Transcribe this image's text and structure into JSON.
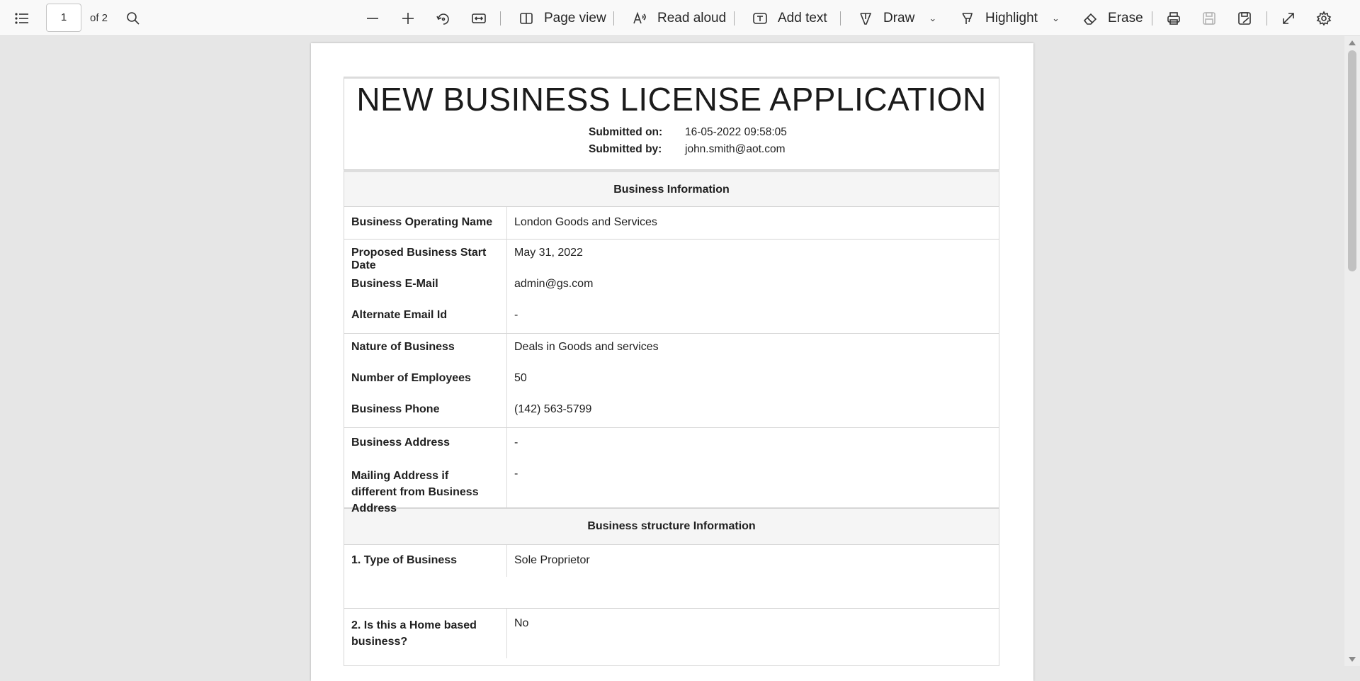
{
  "toolbar": {
    "page_number": "1",
    "page_count": "of 2",
    "page_view": "Page view",
    "read_aloud": "Read aloud",
    "add_text": "Add text",
    "draw": "Draw",
    "highlight": "Highlight",
    "erase": "Erase"
  },
  "document": {
    "title": "NEW BUSINESS LICENSE APPLICATION",
    "submitted_on_label": "Submitted on:",
    "submitted_on": "16-05-2022 09:58:05",
    "submitted_by_label": "Submitted by:",
    "submitted_by": "john.smith@aot.com",
    "section1": "Business Information",
    "fields": [
      {
        "label": "Business Operating Name",
        "value": "London Goods and Services"
      },
      {
        "label": "Proposed Business Start Date",
        "value": "May 31, 2022"
      },
      {
        "label": "Business E-Mail",
        "value": "admin@gs.com"
      },
      {
        "label": "Alternate Email Id",
        "value": "-"
      },
      {
        "label": "Nature of Business",
        "value": "Deals in Goods and services"
      },
      {
        "label": "Number of Employees",
        "value": "50"
      },
      {
        "label": "Business Phone",
        "value": "(142) 563-5799"
      },
      {
        "label": "Business Address",
        "value": "-"
      },
      {
        "label": "Mailing Address if different from Business Address",
        "value": "-"
      }
    ],
    "section2": "Business structure Information",
    "fields2": [
      {
        "label": "1. Type of Business",
        "value": "Sole Proprietor"
      },
      {
        "label": "2. Is this a Home based business?",
        "value": "No"
      }
    ]
  }
}
